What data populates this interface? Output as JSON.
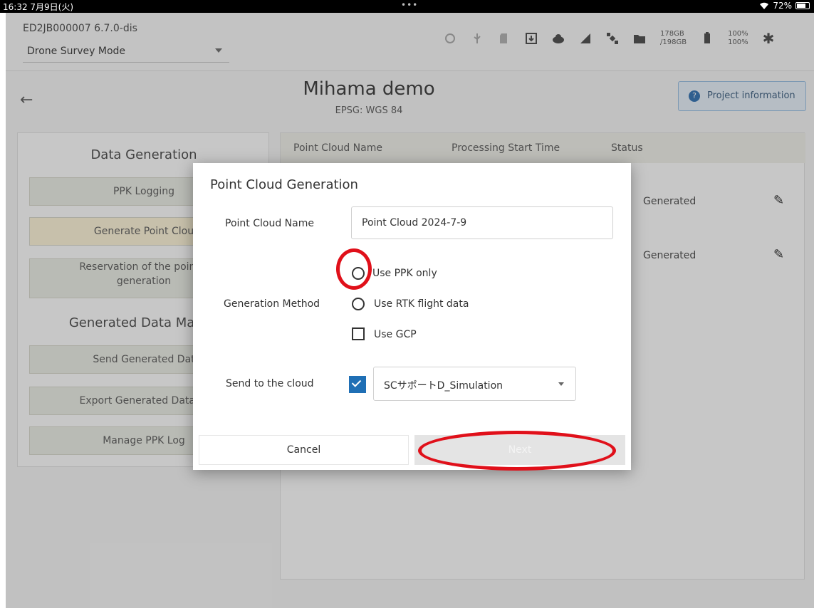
{
  "status_bar": {
    "time": "16:32 7月9日(火)",
    "dots": "•••",
    "battery": "72%"
  },
  "appbar": {
    "device_id": "ED2JB000007   6.7.0-dis",
    "mode": "Drone Survey Mode",
    "storage_line1": "178GB",
    "storage_line2": "/198GB",
    "pct_line1": "100%",
    "pct_line2": "100%",
    "icons": [
      "sync-icon",
      "usb-icon",
      "sd-card-icon",
      "download-icon",
      "cloud-icon",
      "signal-icon",
      "satellite-icon",
      "folder-icon",
      "battery-icon",
      "gear-icon"
    ]
  },
  "project": {
    "title": "Mihama demo",
    "subtitle": "EPSG: WGS 84",
    "info_button": "Project information"
  },
  "left_panel": {
    "section1": "Data Generation",
    "section2": "Generated Data Manag",
    "buttons": [
      "PPK Logging",
      "Generate Point Clou",
      "Reservation of the point-c",
      "generation",
      "Send Generated Dat",
      "Export Generated Data to",
      "Manage PPK Log"
    ]
  },
  "right_panel": {
    "columns": [
      "Point Cloud Name",
      "Processing Start Time",
      "Status"
    ],
    "rows": [
      {
        "status": "Generated"
      },
      {
        "status": "Generated"
      }
    ]
  },
  "dialog": {
    "title": "Point Cloud Generation",
    "name_label": "Point Cloud Name",
    "name_value": "Point Cloud 2024-7-9",
    "method_label": "Generation Method",
    "opt_ppk": "Use PPK only",
    "opt_rtk": "Use RTK flight data",
    "opt_gcp": "Use GCP",
    "cloud_label": "Send to the cloud",
    "cloud_value": "SCサポートD_Simulation",
    "cancel": "Cancel",
    "next": "Next"
  },
  "colors": {
    "accent": "#1f6fb5",
    "annotation": "#e0101a"
  }
}
